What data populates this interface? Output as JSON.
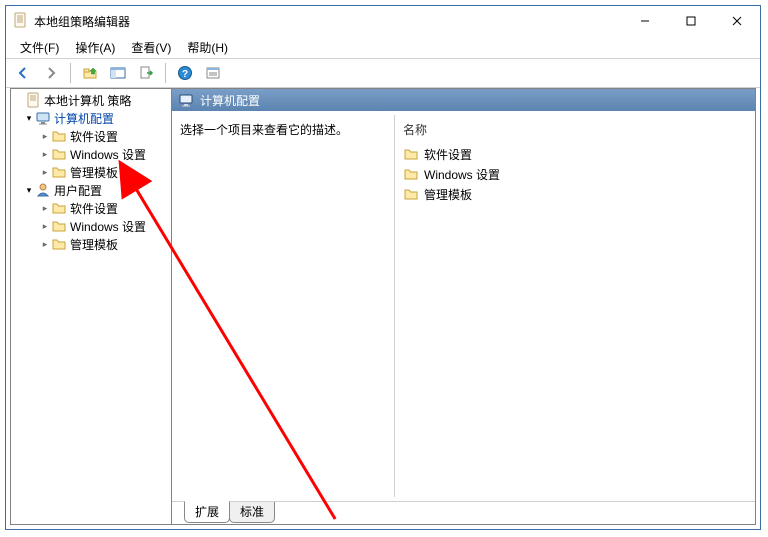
{
  "window": {
    "title": "本地组策略编辑器"
  },
  "menu": {
    "file": "文件(F)",
    "action": "操作(A)",
    "view": "查看(V)",
    "help": "帮助(H)"
  },
  "tree": {
    "root": "本地计算机 策略",
    "computer_config": "计算机配置",
    "cc_software": "软件设置",
    "cc_windows": "Windows 设置",
    "cc_templates": "管理模板",
    "user_config": "用户配置",
    "uc_software": "软件设置",
    "uc_windows": "Windows 设置",
    "uc_templates": "管理模板"
  },
  "right": {
    "header": "计算机配置",
    "description": "选择一个项目来查看它的描述。",
    "col_name": "名称",
    "items": {
      "software": "软件设置",
      "windows": "Windows 设置",
      "templates": "管理模板"
    }
  },
  "tabs": {
    "extended": "扩展",
    "standard": "标准"
  }
}
